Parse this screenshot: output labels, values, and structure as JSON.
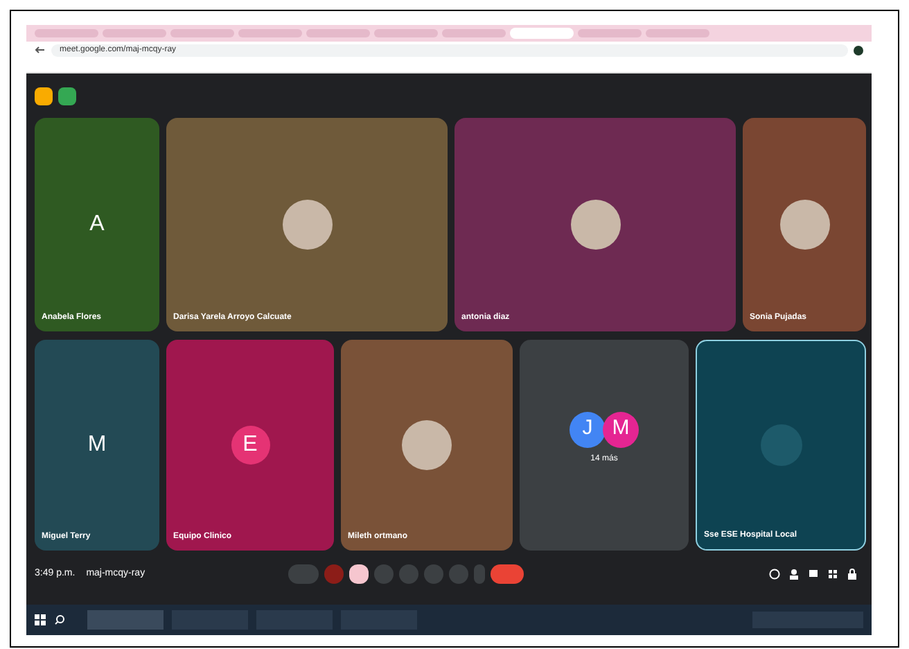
{
  "browser": {
    "address": "meet.google.com/maj-mcqy-ray"
  },
  "tile_rows": [
    [
      {
        "kind": "letter",
        "avatar": {
          "letter": "A"
        },
        "name": "Anabela Flores",
        "color": "#2f5a22"
      },
      {
        "kind": "photo",
        "name": "Darisa Yarela Arroyo Calcuate",
        "color": "#6f5a3a"
      },
      {
        "kind": "photo",
        "name": "antonia diaz",
        "color": "#6e2a52"
      },
      {
        "kind": "photo",
        "name": "Sonia Pujadas",
        "color": "#7a4632"
      }
    ],
    [
      {
        "kind": "letter",
        "avatar": {
          "letter": "M"
        },
        "name": "Miguel Terry",
        "color": "#234a55"
      },
      {
        "kind": "letter",
        "avatar": {
          "letter": "E",
          "color": "#e53374"
        },
        "name": "Equipo Clinico",
        "color": "#a0174e"
      },
      {
        "kind": "photo",
        "name": "Mileth ortmano",
        "color": "#7a5238"
      },
      {
        "kind": "group",
        "letters": [
          "J",
          "M"
        ],
        "caption": "14 más",
        "color": "#3c4043"
      },
      {
        "kind": "screen",
        "name": "Sse ESE Hospital Local",
        "color": "#0e4352"
      }
    ]
  ],
  "meeting": {
    "time": "3:49 p.m.",
    "code": "maj-mcqy-ray"
  }
}
